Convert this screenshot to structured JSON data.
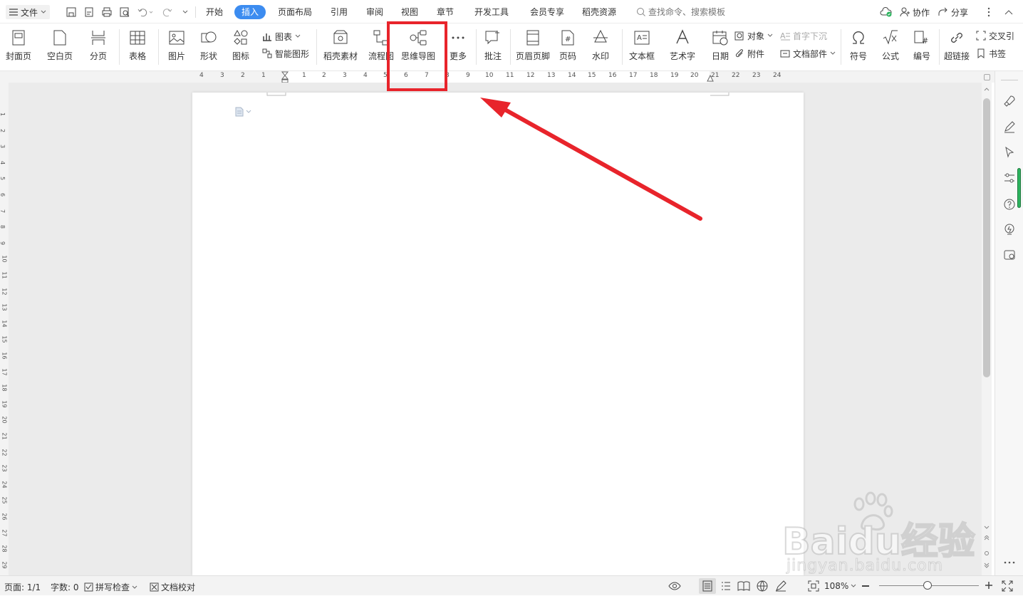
{
  "titlebar": {
    "file_menu": "文件",
    "tabs": [
      "开始",
      "插入",
      "页面布局",
      "引用",
      "审阅",
      "视图",
      "章节",
      "开发工具",
      "会员专享",
      "稻壳资源"
    ],
    "active_tab": "插入",
    "search_placeholder": "查找命令、搜索模板",
    "collab": "协作",
    "share": "分享"
  },
  "ribbon": {
    "cover": "封面页",
    "blank": "空白页",
    "pagebreak": "分页",
    "table": "表格",
    "picture": "图片",
    "shape": "形状",
    "icon": "图标",
    "chart": "图表",
    "smartart": "智能图形",
    "docer": "稻壳素材",
    "flowchart": "流程图",
    "mindmap": "思维导图",
    "more": "更多",
    "comment": "批注",
    "header_footer": "页眉页脚",
    "pagenum": "页码",
    "watermark": "水印",
    "textbox": "文本框",
    "wordart": "艺术字",
    "date": "日期",
    "object": "对象",
    "dropcap": "首字下沉",
    "attachment": "附件",
    "docpart": "文档部件",
    "symbol": "符号",
    "formula": "公式",
    "numbering": "编号",
    "hyperlink": "超链接",
    "crossref": "交叉引",
    "bookmark": "书签"
  },
  "ruler": {
    "left_numbers": [
      "4",
      "3",
      "2",
      "1"
    ],
    "right_numbers": [
      "1",
      "2",
      "3",
      "4",
      "5",
      "6",
      "7",
      "8",
      "9",
      "10",
      "11",
      "12",
      "13",
      "14",
      "15",
      "16",
      "17",
      "18",
      "19",
      "20",
      "21",
      "22",
      "23",
      "24"
    ]
  },
  "vruler": {
    "numbers": [
      "1",
      "2",
      "3",
      "4",
      "5",
      "6",
      "7",
      "8",
      "9",
      "10",
      "11",
      "12",
      "13",
      "14",
      "15",
      "16",
      "17",
      "18",
      "19",
      "20",
      "21",
      "22",
      "23",
      "24",
      "25",
      "26",
      "27",
      "28",
      "29"
    ]
  },
  "status": {
    "page": "页面: 1/1",
    "words": "字数: 0",
    "spell": "拼写检查",
    "proof": "文档校对",
    "zoom": "108%"
  },
  "colors": {
    "accent": "#3c8cf0",
    "highlight": "#e8242b",
    "arrow": "#e8242b"
  },
  "watermark": {
    "brand": "Baidu经验",
    "url": "jingyan.baidu.com"
  }
}
